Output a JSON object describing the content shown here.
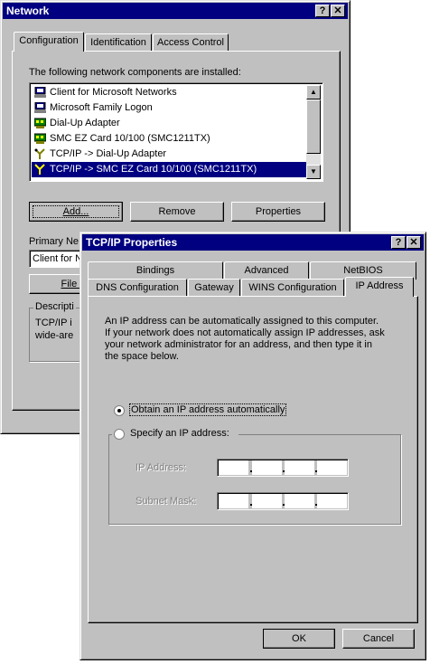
{
  "network": {
    "title": "Network",
    "tabs": [
      "Configuration",
      "Identification",
      "Access Control"
    ],
    "components_label": "The following network components are installed:",
    "components": [
      {
        "label": "Client for Microsoft Networks",
        "icon": "network-client-icon"
      },
      {
        "label": "Microsoft Family Logon",
        "icon": "network-client-icon"
      },
      {
        "label": "Dial-Up Adapter",
        "icon": "adapter-card-icon"
      },
      {
        "label": "SMC EZ Card 10/100 (SMC1211TX)",
        "icon": "adapter-card-icon"
      },
      {
        "label": "TCP/IP -> Dial-Up Adapter",
        "icon": "protocol-icon"
      },
      {
        "label": "TCP/IP -> SMC EZ Card 10/100 (SMC1211TX)",
        "icon": "protocol-icon",
        "selected": true
      }
    ],
    "buttons": {
      "add": "Add...",
      "remove": "Remove",
      "properties": "Properties"
    },
    "primary_logon_label": "Primary Ne",
    "primary_logon_value": "Client for N",
    "file_sharing_button": "File an",
    "description_label": "Descripti",
    "description_lines": [
      "TCP/IP i",
      "wide-are"
    ]
  },
  "tcpip": {
    "title": "TCP/IP Properties",
    "tabs_row1": [
      "Bindings",
      "Advanced",
      "NetBIOS"
    ],
    "tabs_row2": [
      "DNS Configuration",
      "Gateway",
      "WINS Configuration",
      "IP Address"
    ],
    "active_tab": "IP Address",
    "description_lines": [
      "An IP address can be automatically assigned to this computer.",
      "If your network does not automatically assign IP addresses, ask",
      "your network administrator for an address, and then type it in",
      "the space below."
    ],
    "option_auto": "Obtain an IP address automatically",
    "option_specify": "Specify an IP address:",
    "ip_address_label": "IP Address:",
    "subnet_mask_label": "Subnet Mask:",
    "ok": "OK",
    "cancel": "Cancel"
  },
  "colors": {
    "titlebar": "#000080",
    "face": "#c0c0c0",
    "selection": "#000080"
  }
}
